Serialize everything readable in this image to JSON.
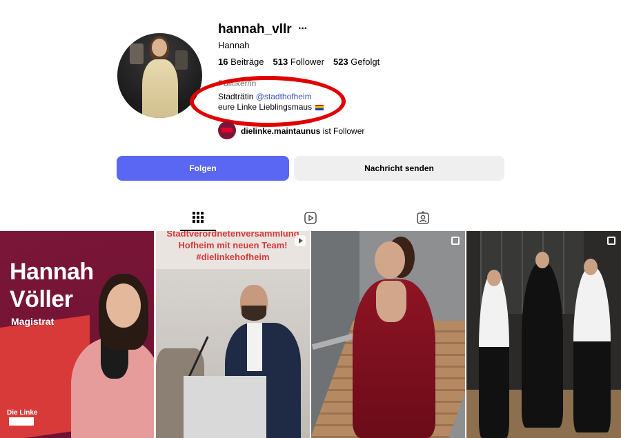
{
  "profile": {
    "username": "hannah_vllr",
    "more_label": "···",
    "full_name": "Hannah",
    "stats": {
      "posts_count": "16",
      "posts_label": "Beiträge",
      "followers_count": "513",
      "followers_label": "Follower",
      "following_count": "523",
      "following_label": "Gefolgt"
    },
    "category": "Politiker/in",
    "bio": {
      "line1_prefix": "Stadträtin ",
      "line1_mention": "@stadthofheim",
      "line2": "eure Linke Lieblingsmaus"
    },
    "followed_by": {
      "account": "dielinke.maintaunus",
      "suffix": " ist Follower"
    },
    "annotation_color": "#e10000"
  },
  "actions": {
    "follow_label": "Folgen",
    "message_label": "Nachricht senden",
    "follow_color": "#5a67f2"
  },
  "tabs": [
    {
      "name": "posts",
      "icon": "grid-icon",
      "active": true
    },
    {
      "name": "reels",
      "icon": "reels-icon",
      "active": false
    },
    {
      "name": "tagged",
      "icon": "tagged-icon",
      "active": false
    }
  ],
  "posts": [
    {
      "type": "image",
      "text_name_line1": "Hannah",
      "text_name_line2": "Völler",
      "text_role": "Magistrat",
      "logo_text": "Die Linke",
      "colors": {
        "background": "#7b1638",
        "accent": "#d83a3a"
      }
    },
    {
      "type": "reel",
      "headline_line1": "Stadtverordnetenversammlung",
      "headline_line2": "Hofheim mit neuen Team!",
      "headline_line3": "#dielinkehofheim",
      "colors": {
        "headline": "#d83a3a"
      }
    },
    {
      "type": "carousel",
      "colors": {
        "dress": "#8e1424"
      }
    },
    {
      "type": "carousel",
      "colors": {
        "background": "#2c2a29"
      }
    }
  ]
}
